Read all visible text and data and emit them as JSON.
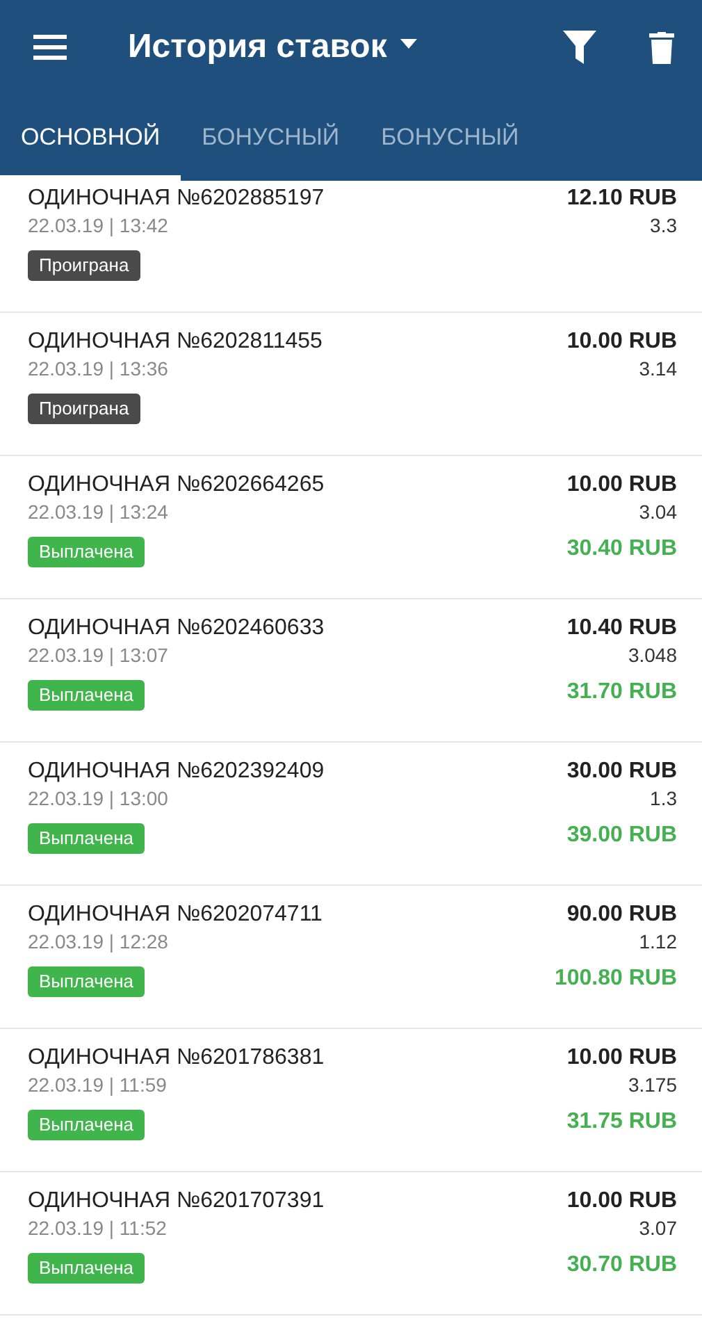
{
  "toolbar": {
    "title": "История ставок"
  },
  "tabs": [
    {
      "label": "ОСНОВНОЙ",
      "selected": true
    },
    {
      "label": "БОНУСНЫЙ",
      "selected": false
    },
    {
      "label": "БОНУСНЫЙ",
      "selected": false
    }
  ],
  "bets": [
    {
      "title": "ОДИНОЧНАЯ №6202885197",
      "date": "22.03.19 | 13:42",
      "status": "Проиграна",
      "kind": "lost",
      "amount": "12.10 RUB",
      "coef": "3.3"
    },
    {
      "title": "ОДИНОЧНАЯ №6202811455",
      "date": "22.03.19 | 13:36",
      "status": "Проиграна",
      "kind": "lost",
      "amount": "10.00 RUB",
      "coef": "3.14"
    },
    {
      "title": "ОДИНОЧНАЯ №6202664265",
      "date": "22.03.19 | 13:24",
      "status": "Выплачена",
      "kind": "paid",
      "amount": "10.00 RUB",
      "coef": "3.04",
      "payout": "30.40 RUB"
    },
    {
      "title": "ОДИНОЧНАЯ №6202460633",
      "date": "22.03.19 | 13:07",
      "status": "Выплачена",
      "kind": "paid",
      "amount": "10.40 RUB",
      "coef": "3.048",
      "payout": "31.70 RUB"
    },
    {
      "title": "ОДИНОЧНАЯ №6202392409",
      "date": "22.03.19 | 13:00",
      "status": "Выплачена",
      "kind": "paid",
      "amount": "30.00 RUB",
      "coef": "1.3",
      "payout": "39.00 RUB"
    },
    {
      "title": "ОДИНОЧНАЯ №6202074711",
      "date": "22.03.19 | 12:28",
      "status": "Выплачена",
      "kind": "paid",
      "amount": "90.00 RUB",
      "coef": "1.12",
      "payout": "100.80 RUB"
    },
    {
      "title": "ОДИНОЧНАЯ №6201786381",
      "date": "22.03.19 | 11:59",
      "status": "Выплачена",
      "kind": "paid",
      "amount": "10.00 RUB",
      "coef": "3.175",
      "payout": "31.75 RUB"
    },
    {
      "title": "ОДИНОЧНАЯ №6201707391",
      "date": "22.03.19 | 11:52",
      "status": "Выплачена",
      "kind": "paid",
      "amount": "10.00 RUB",
      "coef": "3.07",
      "payout": "30.70 RUB"
    }
  ]
}
